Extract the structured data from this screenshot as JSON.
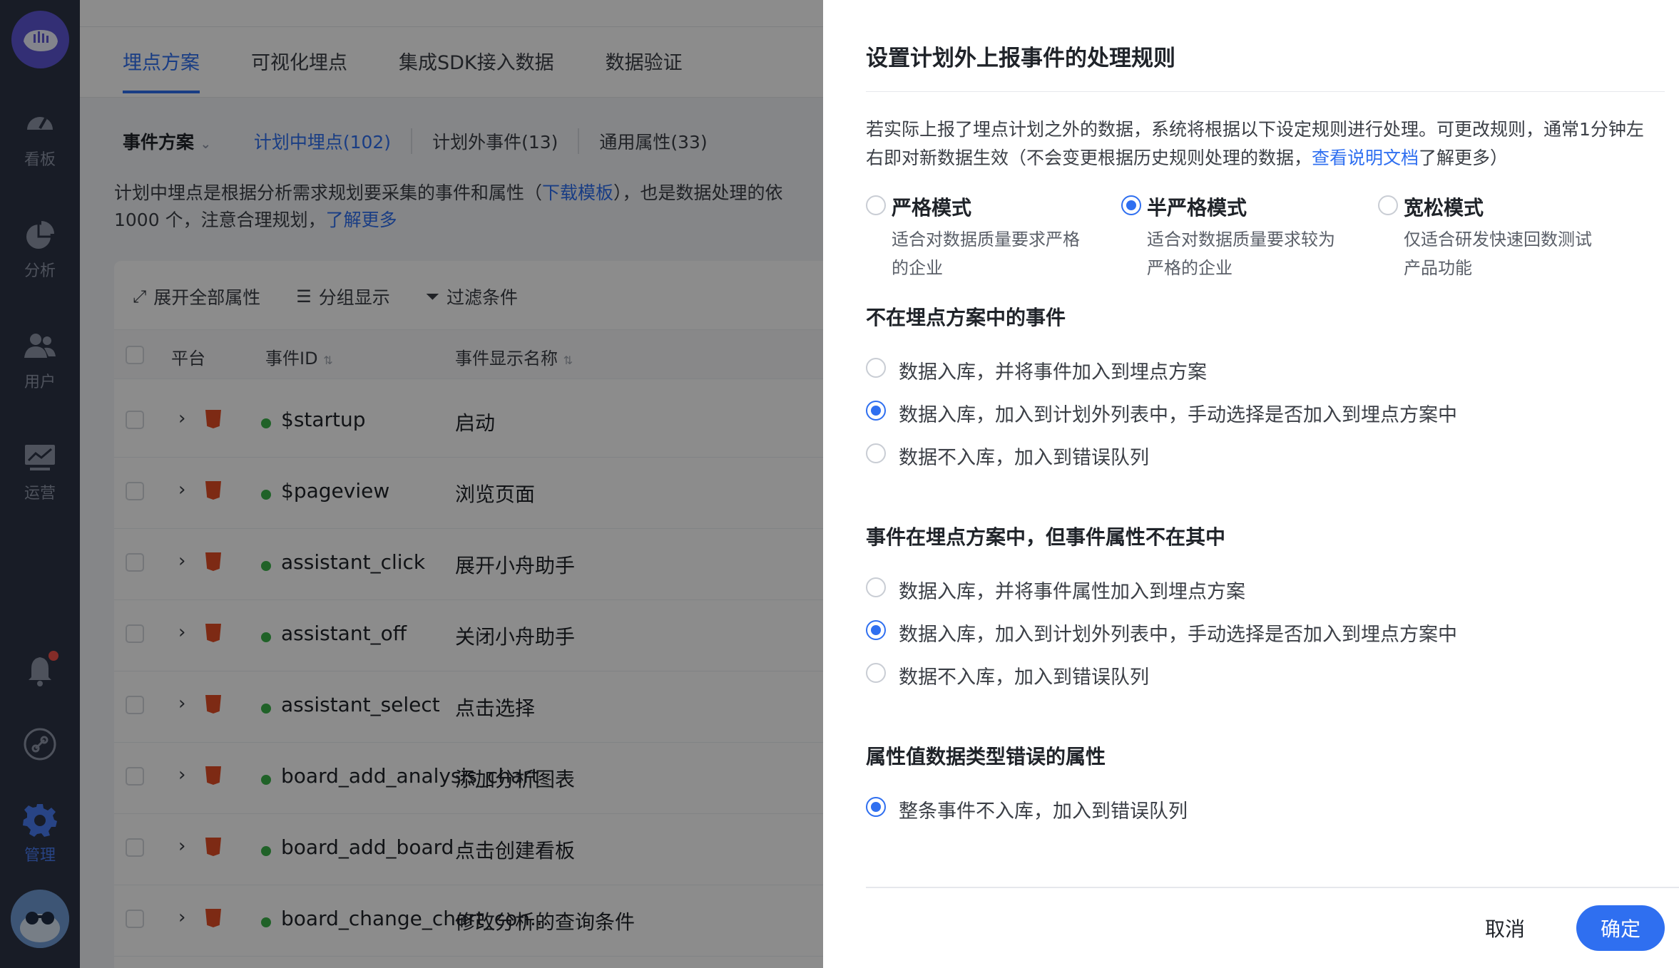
{
  "sidebar": {
    "items": [
      {
        "label": "看板",
        "icon": "dashboard-icon"
      },
      {
        "label": "分析",
        "icon": "pie-chart-icon"
      },
      {
        "label": "用户",
        "icon": "users-icon"
      },
      {
        "label": "运营",
        "icon": "monitor-icon"
      },
      {
        "label": "管理",
        "icon": "gear-icon"
      }
    ]
  },
  "main": {
    "tabs": [
      "埋点方案",
      "可视化埋点",
      "集成SDK接入数据",
      "数据验证"
    ],
    "scheme_dropdown": "事件方案",
    "subtabs": [
      "计划中埋点(102)",
      "计划外事件(13)",
      "通用属性(33)"
    ],
    "desc_part1": "计划中埋点是根据分析需求规划要采集的事件和属性（",
    "desc_link1": "下载模板",
    "desc_part2": "），也是数据处理的依",
    "desc_part3": "1000 个，注意合理规划，",
    "desc_link2": "了解更多",
    "toolbar": {
      "expand": "展开全部属性",
      "group": "分组显示",
      "filter": "过滤条件"
    },
    "columns": {
      "platform": "平台",
      "event_id": "事件ID",
      "event_name": "事件显示名称"
    },
    "rows": [
      {
        "id": "$startup",
        "name": "启动"
      },
      {
        "id": "$pageview",
        "name": "浏览页面"
      },
      {
        "id": "assistant_click",
        "name": "展开小舟助手"
      },
      {
        "id": "assistant_off",
        "name": "关闭小舟助手"
      },
      {
        "id": "assistant_select",
        "name": "点击选择"
      },
      {
        "id": "board_add_analysis_chart",
        "name": "添加分析图表"
      },
      {
        "id": "board_add_board",
        "name": "点击创建看板"
      },
      {
        "id": "board_change_chart_con...",
        "name": "修改分析的查询条件"
      }
    ]
  },
  "drawer": {
    "title": "设置计划外上报事件的处理规则",
    "intro_text": "若实际上报了埋点计划之外的数据，系统将根据以下设定规则进行处理。可更改规则，通常1分钟左右即对新数据生效（不会变更根据历史规则处理的数据，",
    "intro_link": "查看说明文档",
    "intro_tail": "了解更多）",
    "modes": [
      {
        "name": "严格模式",
        "desc": "适合对数据质量要求严格的企业",
        "selected": false
      },
      {
        "name": "半严格模式",
        "desc": "适合对数据质量要求较为严格的企业",
        "selected": true
      },
      {
        "name": "宽松模式",
        "desc": "仅适合研发快速回数测试产品功能",
        "selected": false
      }
    ],
    "section1": {
      "title": "不在埋点方案中的事件",
      "options": [
        {
          "label": "数据入库，并将事件加入到埋点方案",
          "selected": false
        },
        {
          "label": "数据入库，加入到计划外列表中，手动选择是否加入到埋点方案中",
          "selected": true
        },
        {
          "label": "数据不入库，加入到错误队列",
          "selected": false
        }
      ]
    },
    "section2": {
      "title": "事件在埋点方案中，但事件属性不在其中",
      "options": [
        {
          "label": "数据入库，并将事件属性加入到埋点方案",
          "selected": false
        },
        {
          "label": "数据入库，加入到计划外列表中，手动选择是否加入到埋点方案中",
          "selected": true
        },
        {
          "label": "数据不入库，加入到错误队列",
          "selected": false
        }
      ]
    },
    "section3": {
      "title": "属性值数据类型错误的属性",
      "options": [
        {
          "label": "整条事件不入库，加入到错误队列",
          "selected": true
        }
      ]
    },
    "cancel_label": "取消",
    "ok_label": "确定"
  }
}
